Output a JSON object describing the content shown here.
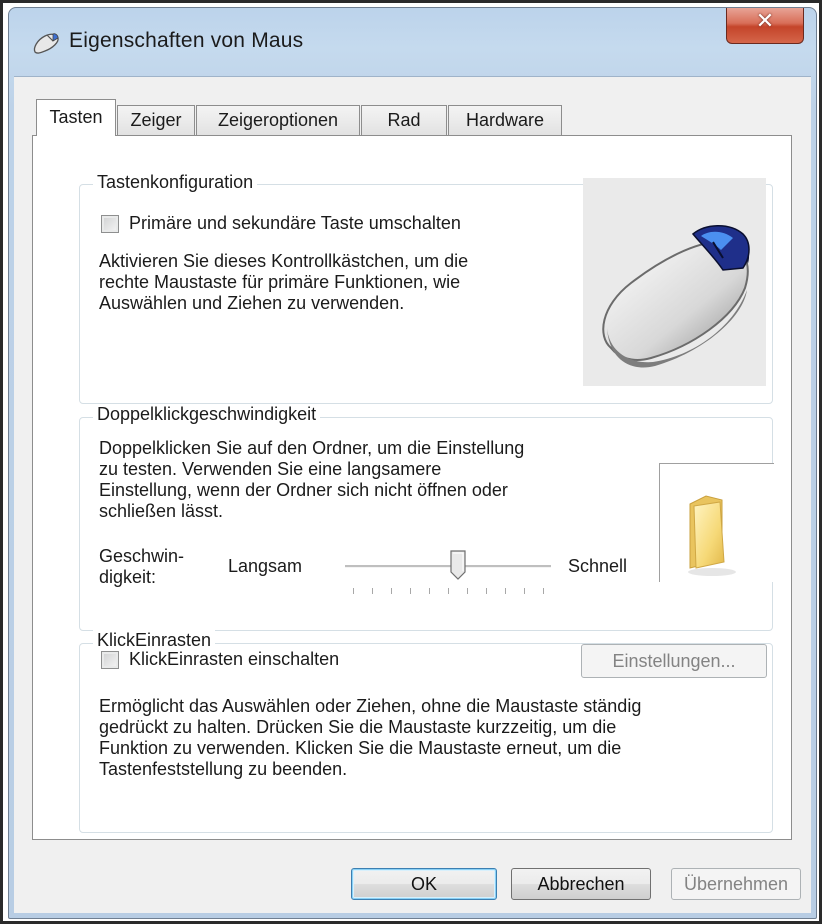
{
  "window": {
    "title": "Eigenschaften von Maus",
    "close_glyph": "✕"
  },
  "tabs": [
    {
      "label": "Tasten",
      "active": true
    },
    {
      "label": "Zeiger",
      "active": false
    },
    {
      "label": "Zeigeroptionen",
      "active": false
    },
    {
      "label": "Rad",
      "active": false
    },
    {
      "label": "Hardware",
      "active": false
    }
  ],
  "button_config": {
    "group_label": "Tastenkonfiguration",
    "checkbox_label": "Primäre und sekundäre Taste umschalten",
    "checkbox_checked": false,
    "description_lines": [
      "Aktivieren Sie dieses Kontrollkästchen, um die",
      "rechte Maustaste für primäre Funktionen, wie",
      "Auswählen und Ziehen zu verwenden."
    ],
    "image_icon": "mouse-icon"
  },
  "double_click": {
    "group_label": "Doppelklickgeschwindigkeit",
    "description_lines": [
      "Doppelklicken Sie auf den Ordner, um die Einstellung",
      "zu testen. Verwenden Sie eine langsamere",
      "Einstellung, wenn der Ordner sich nicht öffnen oder",
      "schließen lässt."
    ],
    "speed_label_lines": [
      "Geschwin-",
      "digkeit:"
    ],
    "slow_label": "Langsam",
    "fast_label": "Schnell",
    "slider_value": 0.55,
    "test_icon": "folder-icon"
  },
  "click_lock": {
    "group_label": "KlickEinrasten",
    "checkbox_label": "KlickEinrasten einschalten",
    "checkbox_checked": false,
    "settings_button": "Einstellungen...",
    "description_lines": [
      "Ermöglicht das Auswählen oder Ziehen, ohne die Maustaste ständig",
      "gedrückt zu halten. Drücken Sie die Maustaste kurzzeitig, um die",
      "Funktion zu verwenden. Klicken Sie die Maustaste erneut, um die",
      "Tastenfeststellung zu beenden."
    ]
  },
  "footer": {
    "ok": "OK",
    "cancel": "Abbrechen",
    "apply": "Übernehmen"
  },
  "colors": {
    "title_gradient": "#bcd3eb",
    "close_button": "#c4442a",
    "client_background": "#f0f0f0"
  }
}
